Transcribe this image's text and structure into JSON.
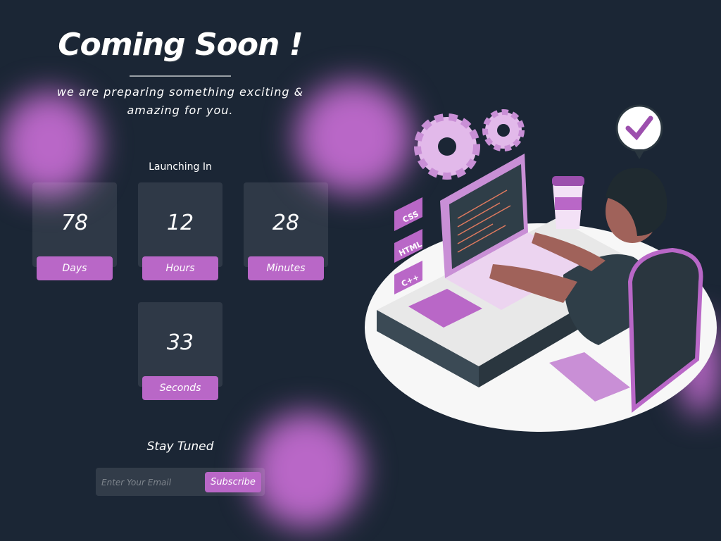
{
  "hero": {
    "title": "Coming Soon !",
    "subtitle": "we are preparing something exciting & amazing for you."
  },
  "countdown": {
    "heading": "Launching In",
    "units": [
      {
        "value": "78",
        "label": "Days"
      },
      {
        "value": "12",
        "label": "Hours"
      },
      {
        "value": "28",
        "label": "Minutes"
      },
      {
        "value": "33",
        "label": "Seconds"
      }
    ]
  },
  "subscribe": {
    "heading": "Stay Tuned",
    "email_placeholder": "Enter Your Email",
    "email_value": "",
    "button_label": "Subscribe"
  },
  "illustration": {
    "tags": [
      "CSS",
      "HTML",
      "C++"
    ]
  },
  "colors": {
    "background": "#1b2635",
    "accent": "#b967c7"
  }
}
